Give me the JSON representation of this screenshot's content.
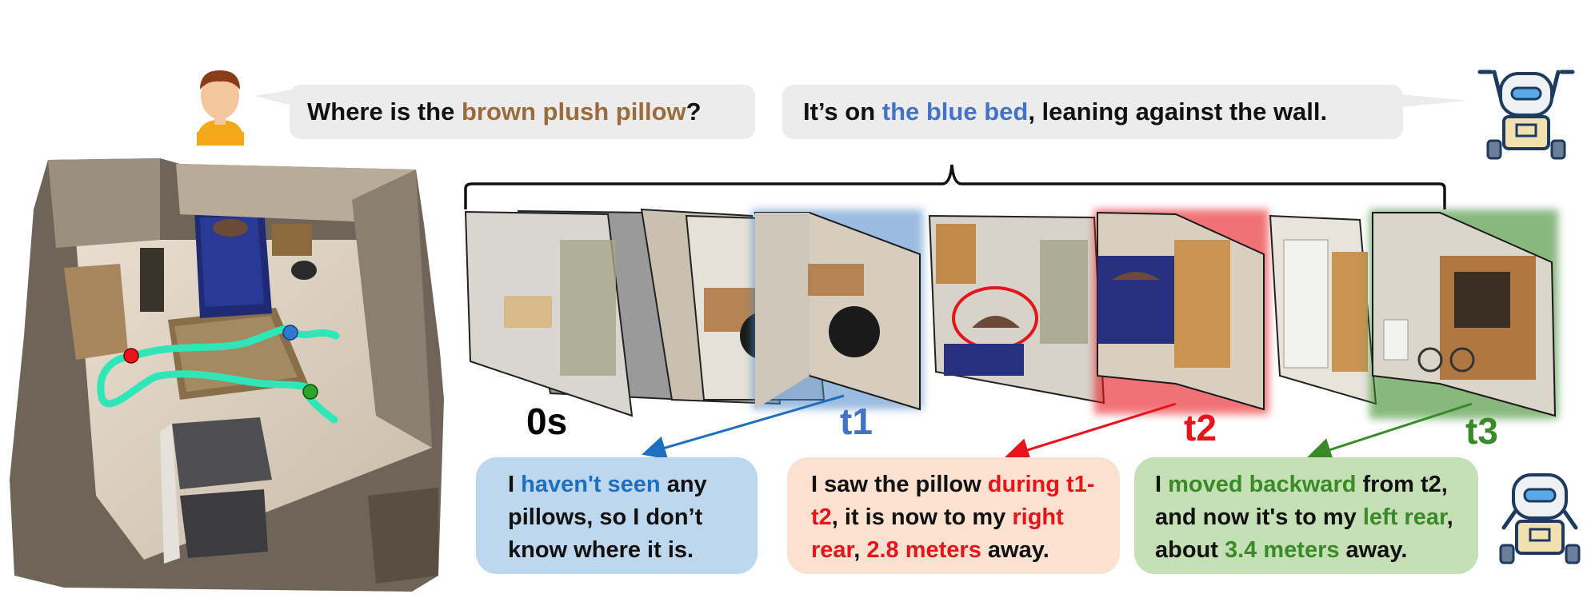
{
  "question": {
    "prefix": "Where is the ",
    "highlight": "brown plush pillow",
    "suffix": "?"
  },
  "response": {
    "prefix": "It’s on ",
    "highlight": "the blue bed",
    "suffix": ", leaning against the wall."
  },
  "time_labels": [
    "0s",
    "t1",
    "t2",
    "t3"
  ],
  "answers": [
    {
      "parts": [
        {
          "text": "I ",
          "color": "plain"
        },
        {
          "text": "haven't seen",
          "color": "blue"
        },
        {
          "text": " any pillows, so I don’t know where it is.",
          "color": "plain"
        }
      ]
    },
    {
      "parts": [
        {
          "text": "I saw the pillow ",
          "color": "plain"
        },
        {
          "text": "during t1-t2",
          "color": "red"
        },
        {
          "text": ", it is now to my ",
          "color": "plain"
        },
        {
          "text": "right rear",
          "color": "red"
        },
        {
          "text": ", ",
          "color": "plain"
        },
        {
          "text": "2.8 meters",
          "color": "red"
        },
        {
          "text": " away.",
          "color": "plain"
        }
      ]
    },
    {
      "parts": [
        {
          "text": "I ",
          "color": "plain"
        },
        {
          "text": "moved backward",
          "color": "green"
        },
        {
          "text": " from t2, and now it's to my ",
          "color": "plain"
        },
        {
          "text": "left rear",
          "color": "green"
        },
        {
          "text": ", about ",
          "color": "plain"
        },
        {
          "text": "3.4 meters",
          "color": "green"
        },
        {
          "text": " away.",
          "color": "plain"
        }
      ]
    }
  ],
  "colors": {
    "brown": "#9a6b3c",
    "blue": "#4472c4",
    "red": "#e8141b",
    "green": "#3a8a2a",
    "path": "#2ee6b8",
    "bubble_gray": "#ececec",
    "answer_blue_bg": "#bdd7ee",
    "answer_peach_bg": "#fbe1cf",
    "answer_green_bg": "#c5e0b4"
  },
  "icons": [
    "user-avatar-icon",
    "robot-icon"
  ]
}
